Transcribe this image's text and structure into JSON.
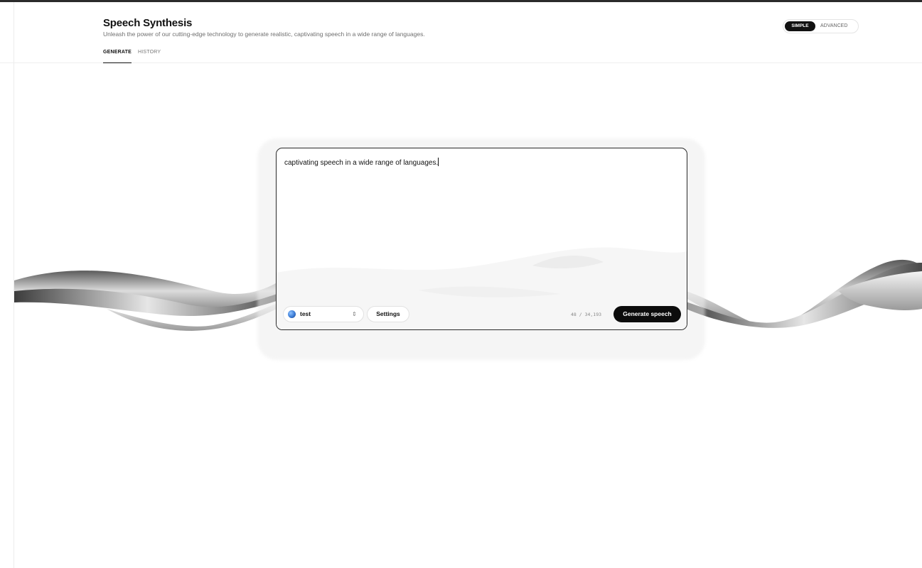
{
  "header": {
    "title": "Speech Synthesis",
    "subtitle": "Unleash the power of our cutting-edge technology to generate realistic, captivating speech in a wide range of languages.",
    "tabs": [
      {
        "label": "GENERATE",
        "active": true
      },
      {
        "label": "HISTORY",
        "active": false
      }
    ]
  },
  "mode_toggle": {
    "options": [
      "SIMPLE",
      "ADVANCED"
    ],
    "selected": "SIMPLE"
  },
  "editor": {
    "text": "captivating speech in a wide range of languages."
  },
  "footer": {
    "voice": {
      "label": "test",
      "avatar_icon": "voice-avatar-icon",
      "chevron_icon": "updown-chevron-icon"
    },
    "settings_label": "Settings",
    "char_count": "48 / 34,193",
    "generate_label": "Generate speech"
  },
  "colors": {
    "accent": "#0c0c0c",
    "background": "#ffffff",
    "muted_text": "#6f6f6f",
    "border": "#e2e2e2"
  }
}
